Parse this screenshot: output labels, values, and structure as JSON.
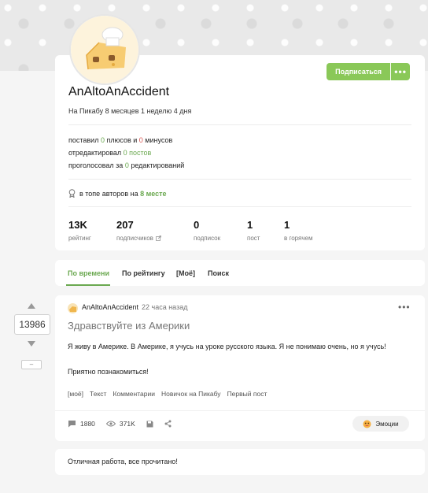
{
  "profile": {
    "username": "AnAltoAnAccident",
    "since": "На Пикабу 8 месяцев 1 неделю 4 дня",
    "subscribe_label": "Подписаться",
    "more_label": "•••",
    "activity": {
      "l1_a": "поставил ",
      "l1_b": "0",
      "l1_c": " плюсов и ",
      "l1_d": "0",
      "l1_e": " минусов",
      "l2_a": "отредактировал ",
      "l2_b": "0 постов",
      "l3_a": "проголосовал за ",
      "l3_b": "0",
      "l3_c": " редактирований"
    },
    "top_authors_a": "в топе авторов на ",
    "top_authors_b": "8 месте",
    "stats": [
      {
        "value": "13K",
        "label": "рейтинг"
      },
      {
        "value": "207",
        "label": "подписчиков"
      },
      {
        "value": "0",
        "label": "подписок"
      },
      {
        "value": "1",
        "label": "пост"
      },
      {
        "value": "1",
        "label": "в горячем"
      }
    ]
  },
  "tabs": [
    {
      "label": "По времени"
    },
    {
      "label": "По рейтингу"
    },
    {
      "label": "[Моё]"
    },
    {
      "label": "Поиск"
    }
  ],
  "vote": {
    "rating": "13986",
    "minus_label": "–"
  },
  "post": {
    "author": "AnAltoAnAccident",
    "time": "22 часа назад",
    "menu": "•••",
    "title": "Здравствуйте из Америки",
    "text1": "Я живу в Америке. В Америке, я учусь на уроке русского языка. Я не понимаю очень, но я учусь!",
    "text2": "Приятно познакомиться!",
    "tags": [
      "[моё]",
      "Текст",
      "Комментарии",
      "Новичок на Пикабу",
      "Первый пост"
    ],
    "comments": "1880",
    "views": "371K",
    "emotions_label": "Эмоции"
  },
  "comment": {
    "text": "Отличная работа, все прочитано!"
  },
  "colors": {
    "accent": "#6aa84f",
    "button": "#8ac858",
    "negative": "#d9534f"
  }
}
